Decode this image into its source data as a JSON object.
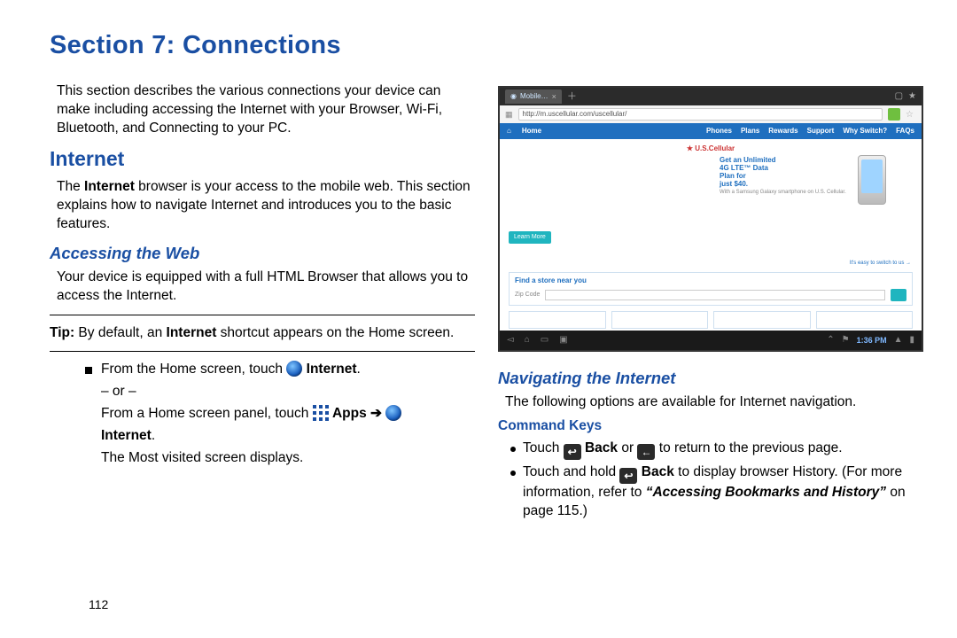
{
  "section_title": "Section 7: Connections",
  "page_number": "112",
  "left": {
    "intro": "This section describes the various connections your device can make including accessing the Internet with your Browser, Wi-Fi, Bluetooth, and Connecting to your PC.",
    "h_internet": "Internet",
    "internet_para_pre": "The ",
    "internet_para_bold": "Internet",
    "internet_para_post": " browser is your access to the mobile web. This section explains how to navigate Internet and introduces you to the basic features.",
    "h_accessing": "Accessing the Web",
    "accessing_para": "Your device is equipped with a full HTML Browser that allows you to access the Internet.",
    "tip_label": "Tip:",
    "tip_pre": " By default, an ",
    "tip_bold": "Internet",
    "tip_post": " shortcut appears on the Home screen.",
    "step1_pre": "From the Home screen, touch ",
    "step1_bold": " Internet",
    "or": "– or –",
    "step2_pre": "From a Home screen panel, touch ",
    "step2_apps": " Apps ",
    "arrow": "➔",
    "step2_internet": "Internet",
    "period": ".",
    "most_visited": "The Most visited screen displays."
  },
  "right": {
    "h_navigating": "Navigating the Internet",
    "nav_para": "The following options are available for Internet navigation.",
    "h_command": "Command Keys",
    "cmd1_pre": "Touch ",
    "cmd1_back": " Back",
    "cmd1_or": " or ",
    "cmd1_post": " to return to the previous page.",
    "cmd2_pre": "Touch and hold ",
    "cmd2_back": " Back",
    "cmd2_mid": " to display browser History. (For more information, refer to ",
    "cmd2_ref": "“Accessing Bookmarks and History”",
    "cmd2_post": " on page 115.)"
  },
  "screenshot": {
    "tab_label": "Mobile…",
    "url": "http://m.uscellular.com/uscellular/",
    "nav_home": "Home",
    "nav_items": [
      "Phones",
      "Plans",
      "Rewards",
      "Support",
      "Why Switch?",
      "FAQs"
    ],
    "logo": "U.S.Cellular",
    "promo_l1": "Get an Unlimited",
    "promo_l2": "4G LTE™ Data",
    "promo_l3": "Plan for",
    "promo_l4": "just $40.",
    "learn_more": "Learn More",
    "find_label": "Find a store near you",
    "zip_label": "Zip Code",
    "sys_time": "1:36 PM"
  }
}
